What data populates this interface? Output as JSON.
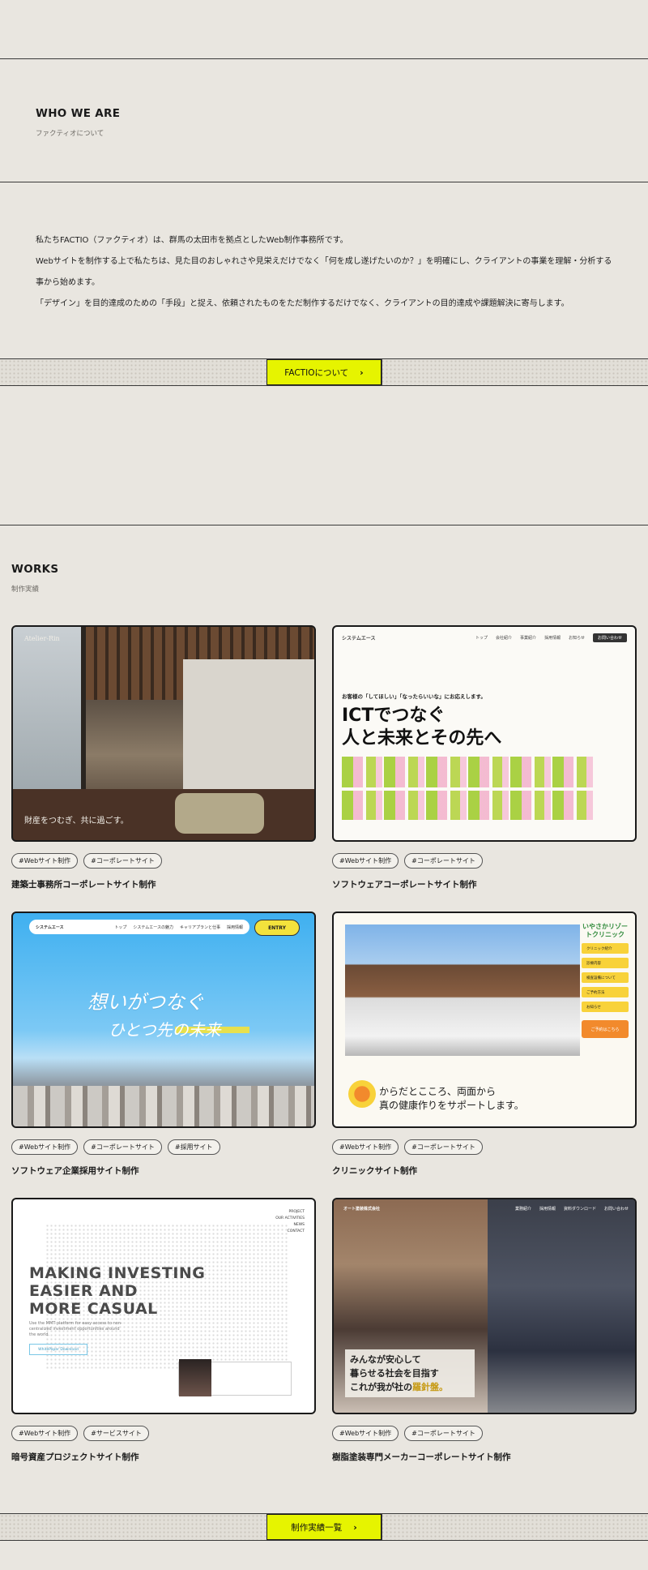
{
  "about_section": {
    "title": "WHO WE ARE",
    "subtitle": "ファクティオについて",
    "paragraphs": [
      "私たちFACTIO（ファクティオ）は、群馬の太田市を拠点としたWeb制作事務所です。",
      "Webサイトを制作する上で私たちは、見た目のおしゃれさや見栄えだけでなく「何を成し遂げたいのか？」を明確にし、クライアントの事業を理解・分析する事から始めます。",
      "「デザイン」を目的達成のための「手段」と捉え、依頼されたものをただ制作するだけでなく、クライアントの目的達成や課題解決に寄与します。"
    ],
    "button_label": "FACTIOについて",
    "button_icon": "chevron-right-icon"
  },
  "works_section": {
    "title": "WORKS",
    "subtitle": "制作実績",
    "button_label": "制作実績一覧",
    "button_icon": "chevron-right-icon",
    "items": [
      {
        "title": "建築士事務所コーポレートサイト制作",
        "tags": [
          "#Webサイト制作",
          "#コーポレートサイト"
        ],
        "thumb_logo": "Atelier-Rin",
        "thumb_copy": "財産をつむぎ、共に過ごす。"
      },
      {
        "title": "ソフトウェアコーポレートサイト制作",
        "tags": [
          "#Webサイト制作",
          "#コーポレートサイト"
        ],
        "thumb_brand": "システムエース",
        "thumb_nav": [
          "トップ",
          "会社紹介",
          "事業紹介",
          "採用情報",
          "お知らせ"
        ],
        "thumb_nav_button": "お問い合わせ",
        "thumb_small": "お客様の「してほしい」「なったらいいな」にお応えします。",
        "thumb_headline_1": "ICTでつなぐ",
        "thumb_headline_2": "人と未来とその先へ"
      },
      {
        "title": "ソフトウェア企業採用サイト制作",
        "tags": [
          "#Webサイト制作",
          "#コーポレートサイト",
          "#採用サイト"
        ],
        "thumb_brand": "システムエース",
        "thumb_nav": [
          "トップ",
          "システムエースの魅力",
          "キャリアプランと仕事",
          "採用情報"
        ],
        "thumb_entry": "ENTRY",
        "thumb_headline_1": "想いがつなぐ",
        "thumb_headline_2": "ひとつ先の未来"
      },
      {
        "title": "クリニックサイト制作",
        "tags": [
          "#Webサイト制作",
          "#コーポレートサイト"
        ],
        "thumb_logo": "いやさかリゾートクリニック",
        "thumb_menu": [
          "クリニック紹介",
          "診療内容",
          "検査設備について",
          "ご予約方法",
          "お知らせ"
        ],
        "thumb_cta": "ご予約はこちら",
        "thumb_copy_1": "からだとこころ、両面から",
        "thumb_copy_2": "真の健康作りをサポートします。"
      },
      {
        "title": "暗号資産プロジェクトサイト制作",
        "tags": [
          "#Webサイト制作",
          "#サービスサイト"
        ],
        "thumb_headline": [
          "MAKING INVESTING",
          "EASIER AND",
          "MORE CASUAL"
        ],
        "thumb_sub": "Use the MMT platform for easy access to non-centralized investment opportunities around the world.",
        "thumb_button": "WhitePaper Download",
        "thumb_menu": [
          "PROJECT",
          "OUR ACTIVITIES",
          "NEWS",
          "CONTACT"
        ]
      },
      {
        "title": "樹脂塗装専門メーカーコーポレートサイト制作",
        "tags": [
          "#Webサイト制作",
          "#コーポレートサイト"
        ],
        "thumb_brand": "オート塗装株式会社",
        "thumb_nav": [
          "業務紹介",
          "採用情報",
          "資料ダウンロード",
          "お問い合わせ"
        ],
        "thumb_copy_1": "みんなが安心して",
        "thumb_copy_2": "暮らせる社会を目指す",
        "thumb_copy_3a": "これが我が社の",
        "thumb_copy_3b": "羅針盤。"
      }
    ]
  },
  "colors": {
    "background": "#e9e6e0",
    "accent_yellow": "#e6f400",
    "text": "#1e1e1e"
  }
}
